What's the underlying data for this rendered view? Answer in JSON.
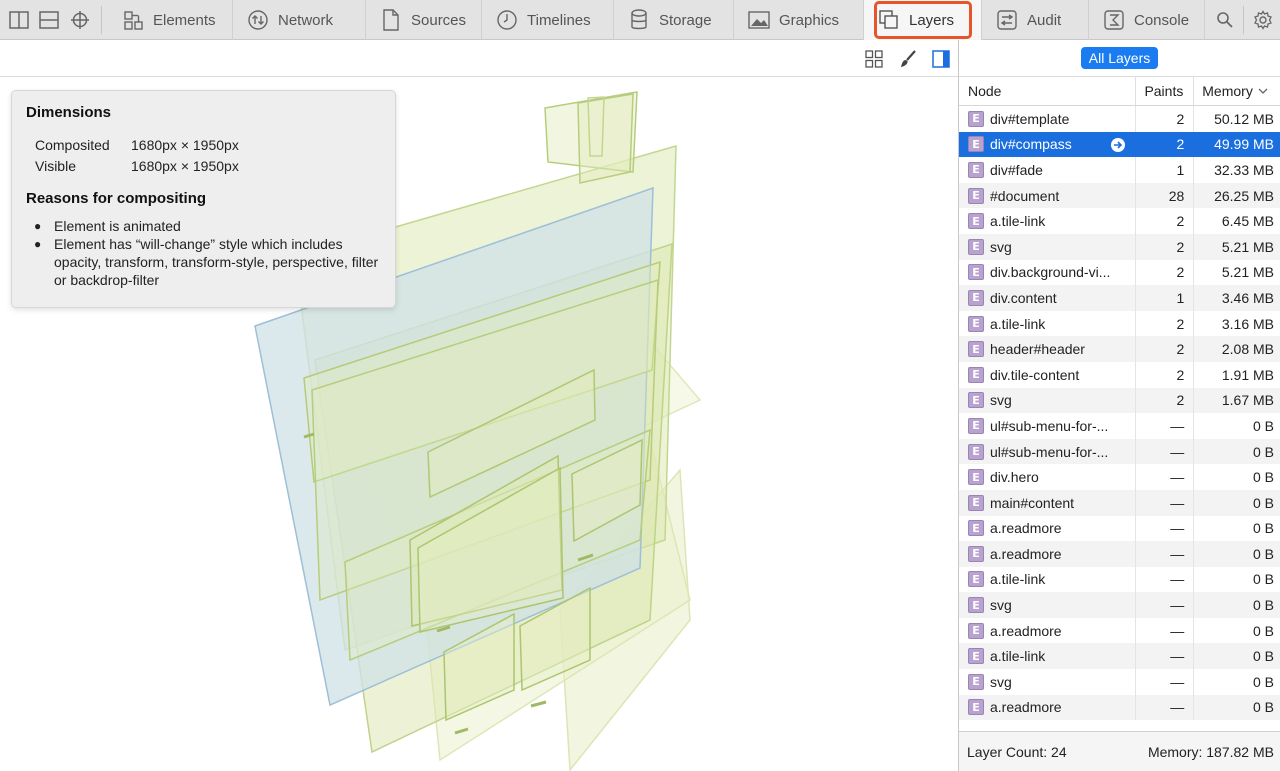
{
  "tabs": [
    {
      "id": "elements",
      "label": "Elements",
      "icon": "elements-icon"
    },
    {
      "id": "network",
      "label": "Network",
      "icon": "network-icon"
    },
    {
      "id": "sources",
      "label": "Sources",
      "icon": "sources-icon"
    },
    {
      "id": "timelines",
      "label": "Timelines",
      "icon": "timelines-icon"
    },
    {
      "id": "storage",
      "label": "Storage",
      "icon": "storage-icon"
    },
    {
      "id": "graphics",
      "label": "Graphics",
      "icon": "graphics-icon"
    },
    {
      "id": "layers",
      "label": "Layers",
      "icon": "layers-icon",
      "selected": true
    },
    {
      "id": "audit",
      "label": "Audit",
      "icon": "audit-icon"
    },
    {
      "id": "console",
      "label": "Console",
      "icon": "console-icon"
    }
  ],
  "highlight_color": "#e8542a",
  "popover": {
    "title": "Dimensions",
    "composited_label": "Composited",
    "composited_value": "1680px × 1950px",
    "visible_label": "Visible",
    "visible_value": "1680px × 1950px",
    "reasons_title": "Reasons for compositing",
    "reasons": [
      "Element is animated",
      "Element has “will-change” style which includes opacity, transform, transform-style, perspective, filter or backdrop-filter"
    ]
  },
  "sidebar": {
    "scope_button": "All Layers",
    "columns": {
      "node": "Node",
      "paints": "Paints",
      "memory": "Memory"
    },
    "badge": "E",
    "rows": [
      {
        "node": "div#template",
        "paints": "2",
        "memory": "50.12 MB"
      },
      {
        "node": "div#compass",
        "paints": "2",
        "memory": "49.99 MB",
        "selected": true
      },
      {
        "node": "div#fade",
        "paints": "1",
        "memory": "32.33 MB"
      },
      {
        "node": "#document",
        "paints": "28",
        "memory": "26.25 MB"
      },
      {
        "node": "a.tile-link",
        "paints": "2",
        "memory": "6.45 MB"
      },
      {
        "node": "svg",
        "paints": "2",
        "memory": "5.21 MB"
      },
      {
        "node": "div.background-vi...",
        "paints": "2",
        "memory": "5.21 MB"
      },
      {
        "node": "div.content",
        "paints": "1",
        "memory": "3.46 MB"
      },
      {
        "node": "a.tile-link",
        "paints": "2",
        "memory": "3.16 MB"
      },
      {
        "node": "header#header",
        "paints": "2",
        "memory": "2.08 MB"
      },
      {
        "node": "div.tile-content",
        "paints": "2",
        "memory": "1.91 MB"
      },
      {
        "node": "svg",
        "paints": "2",
        "memory": "1.67 MB"
      },
      {
        "node": "ul#sub-menu-for-...",
        "paints": "—",
        "memory": "0 B"
      },
      {
        "node": "ul#sub-menu-for-...",
        "paints": "—",
        "memory": "0 B"
      },
      {
        "node": "div.hero",
        "paints": "—",
        "memory": "0 B"
      },
      {
        "node": "main#content",
        "paints": "—",
        "memory": "0 B"
      },
      {
        "node": "a.readmore",
        "paints": "—",
        "memory": "0 B"
      },
      {
        "node": "a.readmore",
        "paints": "—",
        "memory": "0 B"
      },
      {
        "node": "a.tile-link",
        "paints": "—",
        "memory": "0 B"
      },
      {
        "node": "svg",
        "paints": "—",
        "memory": "0 B"
      },
      {
        "node": "a.readmore",
        "paints": "—",
        "memory": "0 B"
      },
      {
        "node": "a.tile-link",
        "paints": "—",
        "memory": "0 B"
      },
      {
        "node": "svg",
        "paints": "—",
        "memory": "0 B"
      },
      {
        "node": "a.readmore",
        "paints": "—",
        "memory": "0 B"
      }
    ],
    "footer_count": "Layer Count: 24",
    "footer_memory": "Memory: 187.82 MB"
  }
}
